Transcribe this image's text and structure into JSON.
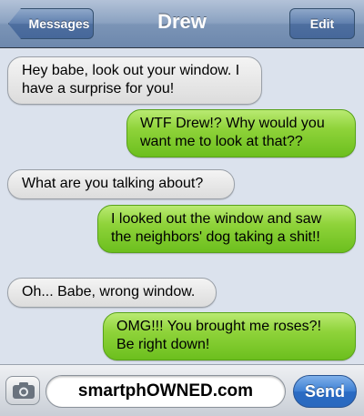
{
  "header": {
    "back_label": "Messages",
    "title": "Drew",
    "edit_label": "Edit"
  },
  "messages": [
    {
      "direction": "incoming",
      "text": "Hey babe, look out your window. I have a surprise for you!"
    },
    {
      "direction": "outgoing",
      "text": "WTF Drew!? Why would you want me to look at that??"
    },
    {
      "direction": "incoming",
      "text": "What are you talking about?"
    },
    {
      "direction": "outgoing",
      "text": "I looked out the window and saw the neighbors' dog taking a shit!!"
    },
    {
      "direction": "incoming",
      "text": "Oh... Babe, wrong window."
    },
    {
      "direction": "outgoing",
      "text": "OMG!!! You brought me roses?! Be right down!"
    }
  ],
  "composer": {
    "input_value": "smartphOWNED.com",
    "send_label": "Send",
    "camera_icon": "camera-icon"
  },
  "colors": {
    "outgoing_bubble": "#8fd33a",
    "incoming_bubble": "#e6e6e6",
    "send_button": "#3d7fd3",
    "nav_bar": "#7b94b6"
  }
}
